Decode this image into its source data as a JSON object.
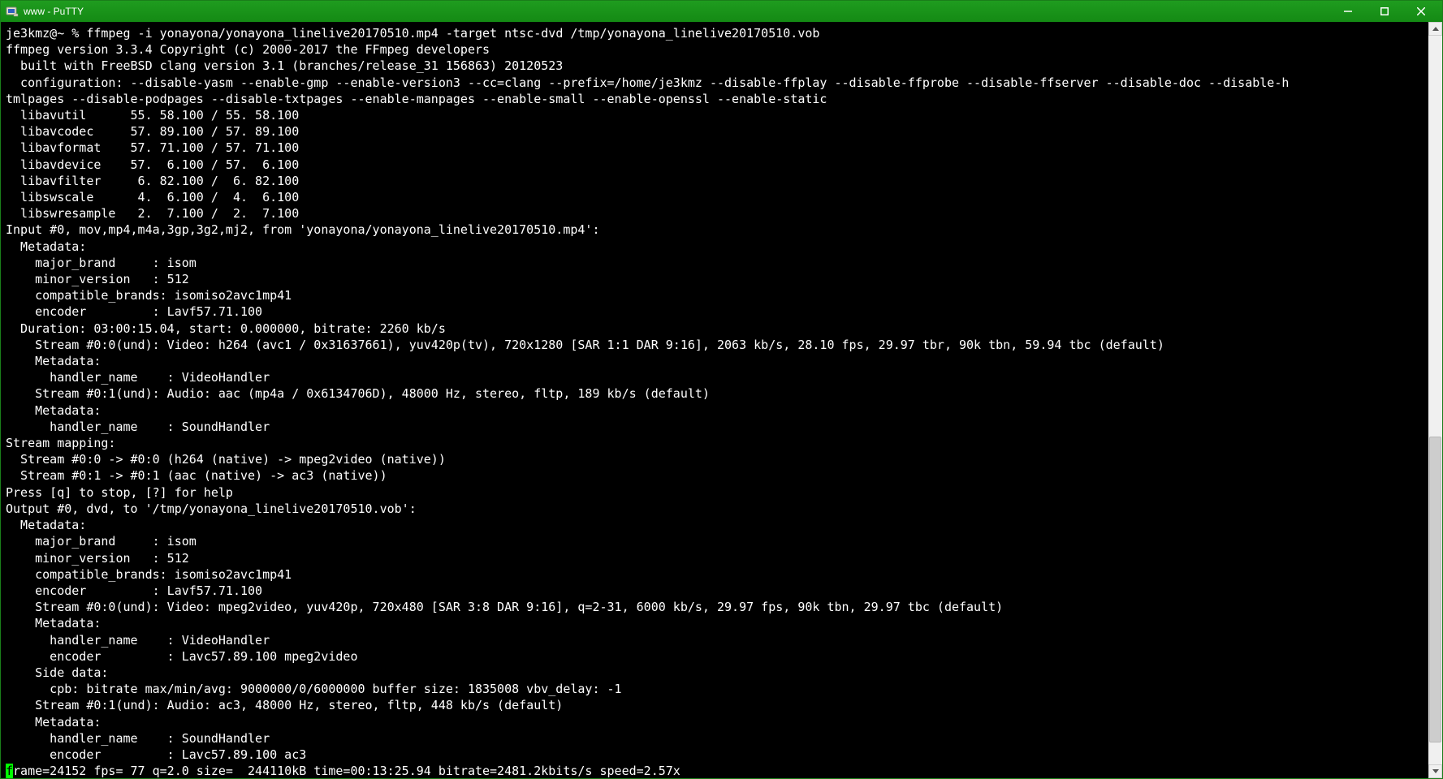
{
  "window": {
    "title": "www - PuTTY"
  },
  "terminal": {
    "prompt": "je3kmz@~ % ",
    "command": "ffmpeg -i yonayona/yonayona_linelive20170510.mp4 -target ntsc-dvd /tmp/yonayona_linelive20170510.vob",
    "lines": [
      "ffmpeg version 3.3.4 Copyright (c) 2000-2017 the FFmpeg developers",
      "  built with FreeBSD clang version 3.1 (branches/release_31 156863) 20120523",
      "  configuration: --disable-yasm --enable-gmp --enable-version3 --cc=clang --prefix=/home/je3kmz --disable-ffplay --disable-ffprobe --disable-ffserver --disable-doc --disable-h",
      "tmlpages --disable-podpages --disable-txtpages --enable-manpages --enable-small --enable-openssl --enable-static",
      "  libavutil      55. 58.100 / 55. 58.100",
      "  libavcodec     57. 89.100 / 57. 89.100",
      "  libavformat    57. 71.100 / 57. 71.100",
      "  libavdevice    57.  6.100 / 57.  6.100",
      "  libavfilter     6. 82.100 /  6. 82.100",
      "  libswscale      4.  6.100 /  4.  6.100",
      "  libswresample   2.  7.100 /  2.  7.100",
      "Input #0, mov,mp4,m4a,3gp,3g2,mj2, from 'yonayona/yonayona_linelive20170510.mp4':",
      "  Metadata:",
      "    major_brand     : isom",
      "    minor_version   : 512",
      "    compatible_brands: isomiso2avc1mp41",
      "    encoder         : Lavf57.71.100",
      "  Duration: 03:00:15.04, start: 0.000000, bitrate: 2260 kb/s",
      "    Stream #0:0(und): Video: h264 (avc1 / 0x31637661), yuv420p(tv), 720x1280 [SAR 1:1 DAR 9:16], 2063 kb/s, 28.10 fps, 29.97 tbr, 90k tbn, 59.94 tbc (default)",
      "    Metadata:",
      "      handler_name    : VideoHandler",
      "    Stream #0:1(und): Audio: aac (mp4a / 0x6134706D), 48000 Hz, stereo, fltp, 189 kb/s (default)",
      "    Metadata:",
      "      handler_name    : SoundHandler",
      "Stream mapping:",
      "  Stream #0:0 -> #0:0 (h264 (native) -> mpeg2video (native))",
      "  Stream #0:1 -> #0:1 (aac (native) -> ac3 (native))",
      "Press [q] to stop, [?] for help",
      "Output #0, dvd, to '/tmp/yonayona_linelive20170510.vob':",
      "  Metadata:",
      "    major_brand     : isom",
      "    minor_version   : 512",
      "    compatible_brands: isomiso2avc1mp41",
      "    encoder         : Lavf57.71.100",
      "    Stream #0:0(und): Video: mpeg2video, yuv420p, 720x480 [SAR 3:8 DAR 9:16], q=2-31, 6000 kb/s, 29.97 fps, 90k tbn, 29.97 tbc (default)",
      "    Metadata:",
      "      handler_name    : VideoHandler",
      "      encoder         : Lavc57.89.100 mpeg2video",
      "    Side data:",
      "      cpb: bitrate max/min/avg: 9000000/0/6000000 buffer size: 1835008 vbv_delay: -1",
      "    Stream #0:1(und): Audio: ac3, 48000 Hz, stereo, fltp, 448 kb/s (default)",
      "    Metadata:",
      "      handler_name    : SoundHandler",
      "      encoder         : Lavc57.89.100 ac3"
    ],
    "status_cursor_char": "f",
    "status_rest": "rame=24152 fps= 77 q=2.0 size=  244110kB time=00:13:25.94 bitrate=2481.2kbits/s speed=2.57x"
  }
}
